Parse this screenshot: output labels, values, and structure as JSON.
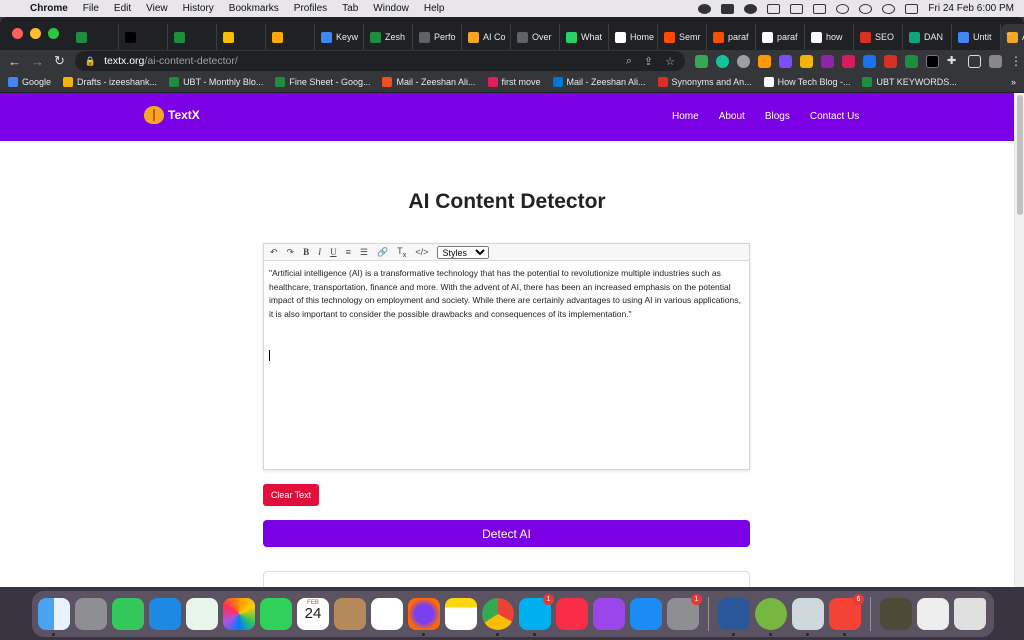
{
  "menubar": {
    "app_name": "Chrome",
    "items": [
      "File",
      "Edit",
      "View",
      "History",
      "Bookmarks",
      "Profiles",
      "Tab",
      "Window",
      "Help"
    ],
    "clock": "Fri 24 Feb  6:00 PM"
  },
  "tabs": [
    {
      "label": "",
      "color": "#1e8e3e"
    },
    {
      "label": "",
      "color": "#000000"
    },
    {
      "label": "",
      "color": "#1e8e3e"
    },
    {
      "label": "",
      "color": "#fbbc04"
    },
    {
      "label": "",
      "color": "#f9ab00"
    },
    {
      "label": "Keyw",
      "color": "#4285f4"
    },
    {
      "label": "Zesh",
      "color": "#1e8e3e"
    },
    {
      "label": "Perfo",
      "color": "#5f6368"
    },
    {
      "label": "AI Co",
      "color": "#f5a623"
    },
    {
      "label": "Over",
      "color": "#5f6368"
    },
    {
      "label": "What",
      "color": "#25d366"
    },
    {
      "label": "Home",
      "color": "#ffffff"
    },
    {
      "label": "Semr",
      "color": "#ff4c00"
    },
    {
      "label": "paraf",
      "color": "#ff4c00"
    },
    {
      "label": "paraf",
      "color": "#ffffff"
    },
    {
      "label": "how",
      "color": "#ffffff"
    },
    {
      "label": "SEO",
      "color": "#d93025"
    },
    {
      "label": "DAN",
      "color": "#10a37f"
    },
    {
      "label": "Untit",
      "color": "#4285f4"
    },
    {
      "label": "A",
      "color": "#f5a623",
      "active": true
    }
  ],
  "address": {
    "host": "textx.org",
    "path": "/ai-content-detector/"
  },
  "bookmarks": [
    {
      "label": "Google",
      "color": "#4285f4"
    },
    {
      "label": "Drafts - izeeshank...",
      "color": "#f4b400"
    },
    {
      "label": "UBT - Monthly Blo...",
      "color": "#1e8e3e"
    },
    {
      "label": "Fine Sheet - Goog...",
      "color": "#1e8e3e"
    },
    {
      "label": "Mail - Zeeshan Ali...",
      "color": "#f25022"
    },
    {
      "label": "first move",
      "color": "#e01e5a"
    },
    {
      "label": "Mail - Zeeshan Ali...",
      "color": "#0078d4"
    },
    {
      "label": "Synonyms and An...",
      "color": "#d93025"
    },
    {
      "label": "How Tech Blog -...",
      "color": "#ffffff"
    },
    {
      "label": "UBT KEYWORDS...",
      "color": "#1e8e3e"
    }
  ],
  "bookmarks_more": "»",
  "site": {
    "brand": "TextX",
    "nav": [
      "Home",
      "About",
      "Blogs",
      "Contact Us"
    ],
    "page_title": "AI Content Detector",
    "editor": {
      "styles_option": "Styles",
      "content": "\"Artificial intelligence (AI) is a transformative technology that has the potential to revolutionize multiple industries such as healthcare, transportation, finance and more. With the advent of AI, there has been an increased emphasis on the potential impact of this technology on employment and society. While there are certainly advantages to using AI in various applications, it is also important to consider the possible drawbacks and consequences of its implementation.\""
    },
    "clear_button": "Clear Text",
    "detect_button": "Detect AI"
  },
  "dock": {
    "calendar_month": "FEB",
    "calendar_day": "24",
    "badges": {
      "skype": "1",
      "settings": "1",
      "files": "6"
    }
  }
}
